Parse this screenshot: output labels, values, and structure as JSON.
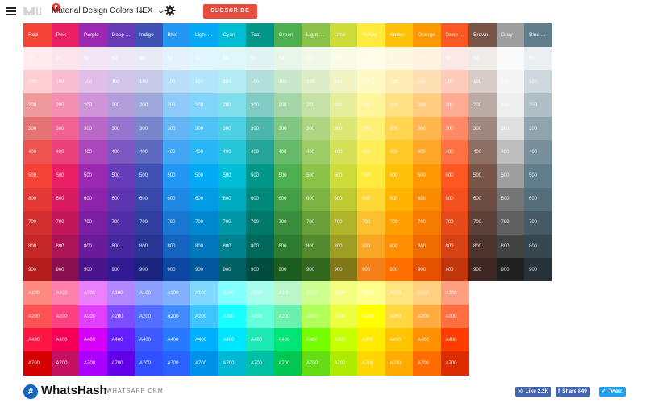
{
  "toolbar": {
    "logo_badge": "6",
    "palette_select": "Material Design Colors",
    "format_select": "HEX",
    "subscribe_label": "SUBSCRIBE"
  },
  "palette": {
    "columns": [
      {
        "name": "Red",
        "colors": {
          "50": "#ffebee",
          "100": "#ffcdd2",
          "200": "#ef9a9a",
          "300": "#e57373",
          "400": "#ef5350",
          "500": "#f44336",
          "600": "#e53935",
          "700": "#d32f2f",
          "800": "#c62828",
          "900": "#b71c1c",
          "A100": "#ff8a80",
          "A200": "#ff5252",
          "A400": "#ff1744",
          "A700": "#d50000"
        }
      },
      {
        "name": "Pink",
        "colors": {
          "50": "#fce4ec",
          "100": "#f8bbd0",
          "200": "#f48fb1",
          "300": "#f06292",
          "400": "#ec407a",
          "500": "#e91e63",
          "600": "#d81b60",
          "700": "#c2185b",
          "800": "#ad1457",
          "900": "#880e4f",
          "A100": "#ff80ab",
          "A200": "#ff4081",
          "A400": "#f50057",
          "A700": "#c51162"
        }
      },
      {
        "name": "Purple",
        "colors": {
          "50": "#f3e5f5",
          "100": "#e1bee7",
          "200": "#ce93d8",
          "300": "#ba68c8",
          "400": "#ab47bc",
          "500": "#9c27b0",
          "600": "#8e24aa",
          "700": "#7b1fa2",
          "800": "#6a1b9a",
          "900": "#4a148c",
          "A100": "#ea80fc",
          "A200": "#e040fb",
          "A400": "#d500f9",
          "A700": "#aa00ff"
        }
      },
      {
        "name": "Deep ...",
        "colors": {
          "50": "#ede7f6",
          "100": "#d1c4e9",
          "200": "#b39ddb",
          "300": "#9575cd",
          "400": "#7e57c2",
          "500": "#673ab7",
          "600": "#5e35b1",
          "700": "#512da8",
          "800": "#4527a0",
          "900": "#311b92",
          "A100": "#b388ff",
          "A200": "#7c4dff",
          "A400": "#651fff",
          "A700": "#6200ea"
        }
      },
      {
        "name": "Indigo",
        "colors": {
          "50": "#e8eaf6",
          "100": "#c5cae9",
          "200": "#9fa8da",
          "300": "#7986cb",
          "400": "#5c6bc0",
          "500": "#3f51b5",
          "600": "#3949ab",
          "700": "#303f9f",
          "800": "#283593",
          "900": "#1a237e",
          "A100": "#8c9eff",
          "A200": "#536dfe",
          "A400": "#3d5afe",
          "A700": "#304ffe"
        }
      },
      {
        "name": "Blue",
        "colors": {
          "50": "#e3f2fd",
          "100": "#bbdefb",
          "200": "#90caf9",
          "300": "#64b5f6",
          "400": "#42a5f5",
          "500": "#2196f3",
          "600": "#1e88e5",
          "700": "#1976d2",
          "800": "#1565c0",
          "900": "#0d47a1",
          "A100": "#82b1ff",
          "A200": "#448aff",
          "A400": "#2979ff",
          "A700": "#2962ff"
        }
      },
      {
        "name": "Light ...",
        "colors": {
          "50": "#e1f5fe",
          "100": "#b3e5fc",
          "200": "#81d4fa",
          "300": "#4fc3f7",
          "400": "#29b6f6",
          "500": "#03a9f4",
          "600": "#039be5",
          "700": "#0288d1",
          "800": "#0277bd",
          "900": "#01579b",
          "A100": "#80d8ff",
          "A200": "#40c4ff",
          "A400": "#00b0ff",
          "A700": "#0091ea"
        }
      },
      {
        "name": "Cyan",
        "colors": {
          "50": "#e0f7fa",
          "100": "#b2ebf2",
          "200": "#80deea",
          "300": "#4dd0e1",
          "400": "#26c6da",
          "500": "#00bcd4",
          "600": "#00acc1",
          "700": "#0097a7",
          "800": "#00838f",
          "900": "#006064",
          "A100": "#84ffff",
          "A200": "#18ffff",
          "A400": "#00e5ff",
          "A700": "#00b8d4"
        }
      },
      {
        "name": "Teal",
        "colors": {
          "50": "#e0f2f1",
          "100": "#b2dfdb",
          "200": "#80cbc4",
          "300": "#4db6ac",
          "400": "#26a69a",
          "500": "#009688",
          "600": "#00897b",
          "700": "#00796b",
          "800": "#00695c",
          "900": "#004d40",
          "A100": "#a7ffeb",
          "A200": "#64ffda",
          "A400": "#1de9b6",
          "A700": "#00bfa5"
        }
      },
      {
        "name": "Green",
        "colors": {
          "50": "#e8f5e9",
          "100": "#c8e6c9",
          "200": "#a5d6a7",
          "300": "#81c784",
          "400": "#66bb6a",
          "500": "#4caf50",
          "600": "#43a047",
          "700": "#388e3c",
          "800": "#2e7d32",
          "900": "#1b5e20",
          "A100": "#b9f6ca",
          "A200": "#69f0ae",
          "A400": "#00e676",
          "A700": "#00c853"
        }
      },
      {
        "name": "Light ...",
        "colors": {
          "50": "#f1f8e9",
          "100": "#dcedc8",
          "200": "#c5e1a5",
          "300": "#aed581",
          "400": "#9ccc65",
          "500": "#8bc34a",
          "600": "#7cb342",
          "700": "#689f38",
          "800": "#558b2f",
          "900": "#33691e",
          "A100": "#ccff90",
          "A200": "#b2ff59",
          "A400": "#76ff03",
          "A700": "#64dd17"
        }
      },
      {
        "name": "Lime",
        "colors": {
          "50": "#f9fbe7",
          "100": "#f0f4c3",
          "200": "#e6ee9c",
          "300": "#dce775",
          "400": "#d4e157",
          "500": "#cddc39",
          "600": "#c0ca33",
          "700": "#afb42b",
          "800": "#9e9d24",
          "900": "#827717",
          "A100": "#f4ff81",
          "A200": "#eeff41",
          "A400": "#c6ff00",
          "A700": "#aeea00"
        }
      },
      {
        "name": "Yellow",
        "colors": {
          "50": "#fffde7",
          "100": "#fff9c4",
          "200": "#fff59d",
          "300": "#fff176",
          "400": "#ffee58",
          "500": "#ffeb3b",
          "600": "#fdd835",
          "700": "#fbc02d",
          "800": "#f9a825",
          "900": "#f57f17",
          "A100": "#ffff8d",
          "A200": "#ffff00",
          "A400": "#ffea00",
          "A700": "#ffd600"
        }
      },
      {
        "name": "Amber",
        "colors": {
          "50": "#fff8e1",
          "100": "#ffecb3",
          "200": "#ffe082",
          "300": "#ffd54f",
          "400": "#ffca28",
          "500": "#ffc107",
          "600": "#ffb300",
          "700": "#ffa000",
          "800": "#ff8f00",
          "900": "#ff6f00",
          "A100": "#ffe57f",
          "A200": "#ffd740",
          "A400": "#ffc400",
          "A700": "#ffab00"
        }
      },
      {
        "name": "Orange",
        "colors": {
          "50": "#fff3e0",
          "100": "#ffe0b2",
          "200": "#ffcc80",
          "300": "#ffb74d",
          "400": "#ffa726",
          "500": "#ff9800",
          "600": "#fb8c00",
          "700": "#f57c00",
          "800": "#ef6c00",
          "900": "#e65100",
          "A100": "#ffd180",
          "A200": "#ffab40",
          "A400": "#ff9100",
          "A700": "#ff6d00"
        }
      },
      {
        "name": "Deep ...",
        "colors": {
          "50": "#fbe9e7",
          "100": "#ffccbc",
          "200": "#ffab91",
          "300": "#ff8a65",
          "400": "#ff7043",
          "500": "#ff5722",
          "600": "#f4511e",
          "700": "#e64a19",
          "800": "#d84315",
          "900": "#bf360c",
          "A100": "#ff9e80",
          "A200": "#ff6e40",
          "A400": "#ff3d00",
          "A700": "#dd2c00"
        }
      },
      {
        "name": "Brown",
        "colors": {
          "50": "#efebe9",
          "100": "#d7ccc8",
          "200": "#bcaaa4",
          "300": "#a1887f",
          "400": "#8d6e63",
          "500": "#795548",
          "600": "#6d4c41",
          "700": "#5d4037",
          "800": "#4e342e",
          "900": "#3e2723"
        }
      },
      {
        "name": "Grey",
        "colors": {
          "50": "#fafafa",
          "100": "#f5f5f5",
          "200": "#eeeeee",
          "300": "#e0e0e0",
          "400": "#bdbdbd",
          "500": "#9e9e9e",
          "600": "#757575",
          "700": "#616161",
          "800": "#424242",
          "900": "#212121"
        }
      },
      {
        "name": "Blue ...",
        "colors": {
          "50": "#eceff1",
          "100": "#cfd8dc",
          "200": "#b0bec5",
          "300": "#90a4ae",
          "400": "#78909c",
          "500": "#607d8b",
          "600": "#546e7a",
          "700": "#455a64",
          "800": "#37474f",
          "900": "#263238"
        }
      }
    ],
    "shades": [
      "50",
      "100",
      "200",
      "300",
      "400",
      "500",
      "600",
      "700",
      "800",
      "900",
      "A100",
      "A200",
      "A400",
      "A700"
    ]
  },
  "footer": {
    "brand_icon": "#",
    "brand_name": "WhatsHash",
    "brand_tagline": "WHATSAPP CRM",
    "like_label": "Like 2.2K",
    "share_label": "Share 849",
    "tweet_label": "Tweet",
    "colors": {
      "like": "#4267b2",
      "share": "#4267b2",
      "tweet": "#1da1f2",
      "subscribe": "#e74c3c"
    }
  }
}
